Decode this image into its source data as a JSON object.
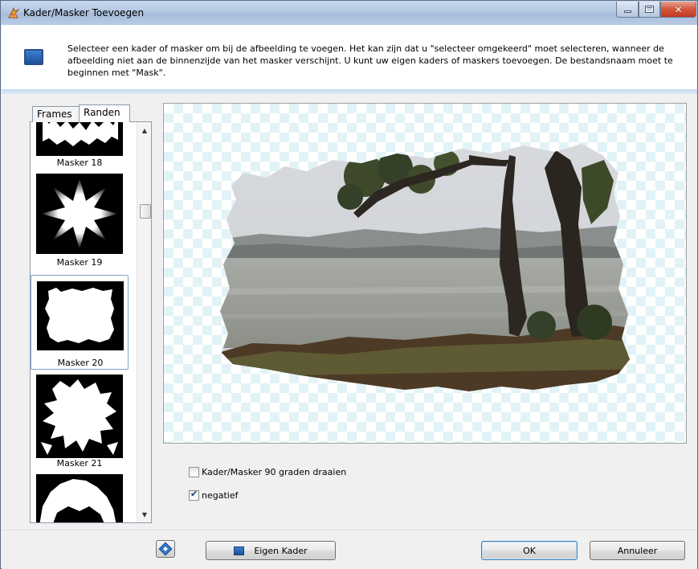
{
  "window": {
    "title": "Kader/Masker Toevoegen",
    "controls": {
      "minimize": "minimize",
      "maximize": "maximize",
      "close": "✕"
    }
  },
  "header": {
    "description": "Selecteer een kader of masker om bij de afbeelding te voegen. Het kan zijn dat u \"selecteer omgekeerd\" moet selecteren, wanneer de afbeelding niet aan de binnenzijde van het masker verschijnt. U kunt uw eigen kaders of maskers toevoegen. De bestandsnaam moet te beginnen met \"Mask\"."
  },
  "tabs": [
    {
      "label": "Frames",
      "active": false
    },
    {
      "label": "Randen",
      "active": true
    }
  ],
  "mask_list": {
    "items": [
      {
        "label": "Masker 18",
        "selected": false
      },
      {
        "label": "Masker 19",
        "selected": false
      },
      {
        "label": "Masker 20",
        "selected": true
      },
      {
        "label": "Masker 21",
        "selected": false
      },
      {
        "label": "",
        "selected": false
      }
    ],
    "scroll_position": 0.2
  },
  "options": {
    "rotate_label": "Kader/Masker 90 graden draaien",
    "rotate_checked": false,
    "negative_label": "negatief",
    "negative_checked": true
  },
  "buttons": {
    "help": "help",
    "own_frame": "Eigen Kader",
    "ok": "OK",
    "cancel": "Annuleer"
  },
  "colors": {
    "accent": "#3b7fd0",
    "checker": "#e2f3f7",
    "close": "#c13a20"
  }
}
